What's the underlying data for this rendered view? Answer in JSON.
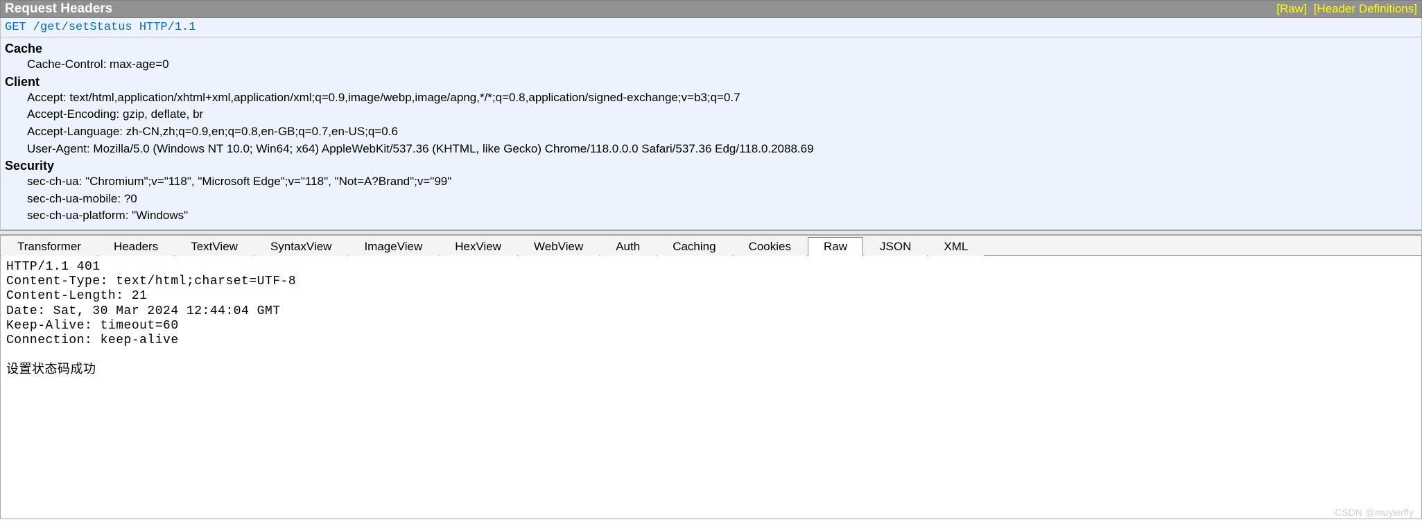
{
  "header_bar": {
    "title": "Request Headers",
    "raw_link": "[Raw]",
    "defs_link": "[Header Definitions]"
  },
  "request_line": "GET /get/setStatus HTTP/1.1",
  "groups": [
    {
      "name": "Cache",
      "items": [
        {
          "k": "Cache-Control",
          "v": "max-age=0"
        }
      ]
    },
    {
      "name": "Client",
      "items": [
        {
          "k": "Accept",
          "v": "text/html,application/xhtml+xml,application/xml;q=0.9,image/webp,image/apng,*/*;q=0.8,application/signed-exchange;v=b3;q=0.7"
        },
        {
          "k": "Accept-Encoding",
          "v": "gzip, deflate, br"
        },
        {
          "k": "Accept-Language",
          "v": "zh-CN,zh;q=0.9,en;q=0.8,en-GB;q=0.7,en-US;q=0.6"
        },
        {
          "k": "User-Agent",
          "v": "Mozilla/5.0 (Windows NT 10.0; Win64; x64) AppleWebKit/537.36 (KHTML, like Gecko) Chrome/118.0.0.0 Safari/537.36 Edg/118.0.2088.69"
        }
      ]
    },
    {
      "name": "Security",
      "items": [
        {
          "k": "sec-ch-ua",
          "v": "\"Chromium\";v=\"118\", \"Microsoft Edge\";v=\"118\", \"Not=A?Brand\";v=\"99\""
        },
        {
          "k": "sec-ch-ua-mobile",
          "v": "?0"
        },
        {
          "k": "sec-ch-ua-platform",
          "v": "\"Windows\""
        }
      ]
    }
  ],
  "tabs": {
    "items": [
      "Transformer",
      "Headers",
      "TextView",
      "SyntaxView",
      "ImageView",
      "HexView",
      "WebView",
      "Auth",
      "Caching",
      "Cookies",
      "Raw",
      "JSON",
      "XML"
    ],
    "active": "Raw"
  },
  "response_raw": "HTTP/1.1 401\nContent-Type: text/html;charset=UTF-8\nContent-Length: 21\nDate: Sat, 30 Mar 2024 12:44:04 GMT\nKeep-Alive: timeout=60\nConnection: keep-alive\n\n设置状态码成功",
  "watermark": "CSDN @muyierfly"
}
